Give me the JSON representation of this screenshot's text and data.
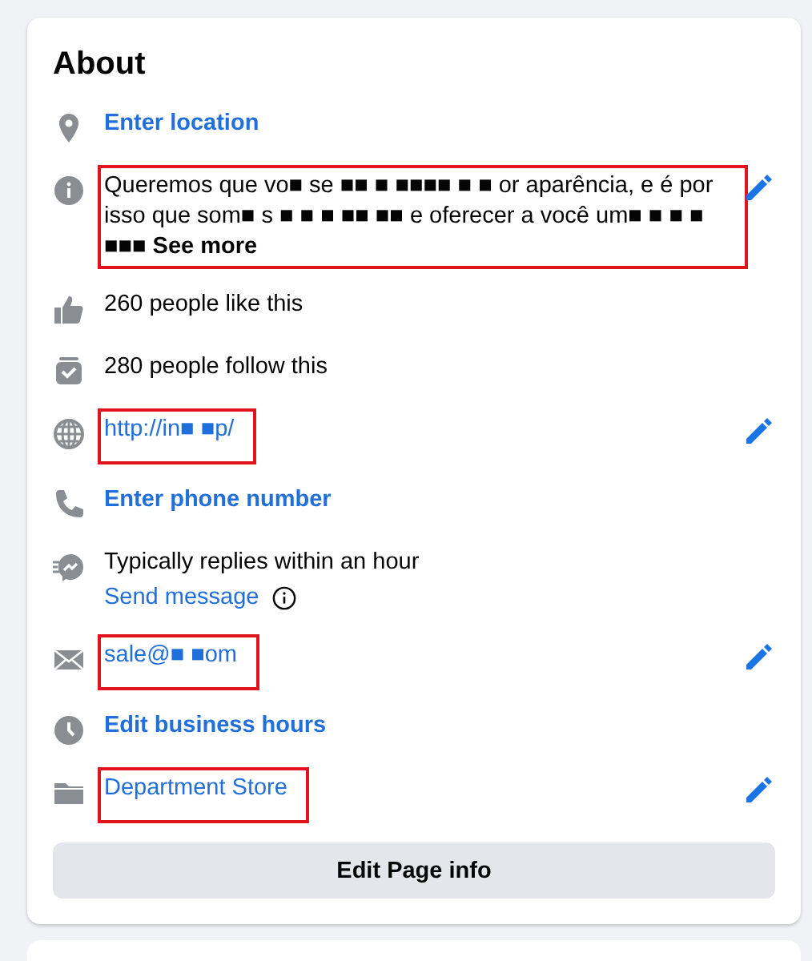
{
  "title": "About",
  "items": [
    {
      "kind": "action",
      "text": "Enter location",
      "editable": false,
      "highlighted": false
    },
    {
      "kind": "text",
      "text": "Queremos que vo■ se ■■ ■ ■■■■ ■ ■ or aparência, e é por isso que som■ s ■ ■ ■ ■■ ■■ e oferecer a você um■ ■ ■ ■ ■■■",
      "more": "See more",
      "editable": true,
      "highlighted": true
    },
    {
      "kind": "text",
      "text": "260 people like this",
      "editable": false,
      "highlighted": false
    },
    {
      "kind": "text",
      "text": "280 people follow this",
      "editable": false,
      "highlighted": false
    },
    {
      "kind": "link",
      "text": "http://in■ ■p/",
      "editable": true,
      "highlighted": true
    },
    {
      "kind": "action",
      "text": "Enter phone number",
      "editable": false,
      "highlighted": false
    },
    {
      "kind": "message",
      "text": "Typically replies within an hour",
      "link": "Send message",
      "editable": false,
      "highlighted": false
    },
    {
      "kind": "link",
      "text": "sale@■ ■om",
      "editable": true,
      "highlighted": true
    },
    {
      "kind": "action",
      "text": "Edit business hours",
      "editable": false,
      "highlighted": false
    },
    {
      "kind": "link",
      "text": "Department Store",
      "editable": true,
      "highlighted": true
    }
  ],
  "button": "Edit Page info"
}
